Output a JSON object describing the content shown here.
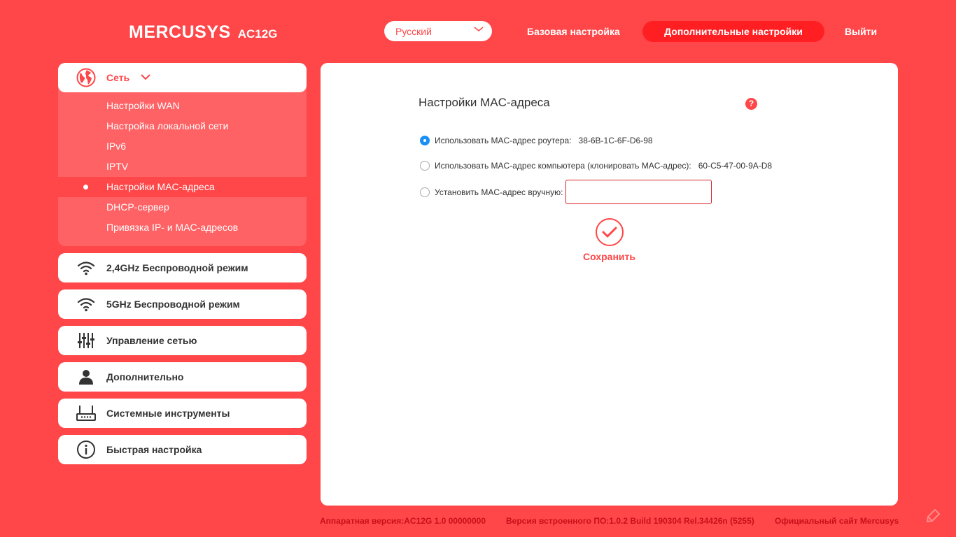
{
  "header": {
    "brand": "MERCUSYS",
    "model": "AC12G",
    "language": "Русский",
    "nav": {
      "basic": "Базовая настройка",
      "advanced": "Дополнительные настройки",
      "logout": "Выйти"
    }
  },
  "sidebar": {
    "network": {
      "label": "Сеть",
      "items": [
        {
          "label": "Настройки WAN"
        },
        {
          "label": "Настройка локальной сети"
        },
        {
          "label": "IPv6"
        },
        {
          "label": "IPTV"
        },
        {
          "label": "Настройки MAC-адреса",
          "active": true
        },
        {
          "label": "DHCP-сервер"
        },
        {
          "label": "Привязка IP- и MAC-адресов"
        }
      ]
    },
    "groups": [
      {
        "label": "2,4GHz Беспроводной режим",
        "icon": "wifi-icon"
      },
      {
        "label": "5GHz Беспроводной режим",
        "icon": "wifi-icon"
      },
      {
        "label": "Управление сетью",
        "icon": "sliders-icon"
      },
      {
        "label": "Дополнительно",
        "icon": "user-icon"
      },
      {
        "label": "Системные инструменты",
        "icon": "router-icon"
      },
      {
        "label": "Быстрая настройка",
        "icon": "info-icon"
      }
    ]
  },
  "main": {
    "title": "Настройки MAC-адреса",
    "help": "?",
    "options": [
      {
        "label": "Использовать MAC-адрес роутера:",
        "value": "38-6B-1C-6F-D6-98",
        "checked": true
      },
      {
        "label": "Использовать MAC-адрес компьютера (клонировать MAC-адрес):",
        "value": "60-C5-47-00-9A-D8",
        "checked": false
      },
      {
        "label": "Установить MAC-адрес вручную:",
        "value": "",
        "checked": false
      }
    ],
    "save_label": "Сохранить"
  },
  "footer": {
    "hardware": "Аппаратная версия:AC12G 1.0 00000000",
    "firmware": "Версия встроенного ПО:1.0.2 Build 190304 Rel.34426n (5255)",
    "site": "Официальный сайт Mercusys"
  },
  "colors": {
    "background": "#ff4648",
    "accent": "#ff1f22",
    "radio_checked": "#1a8ff5"
  }
}
